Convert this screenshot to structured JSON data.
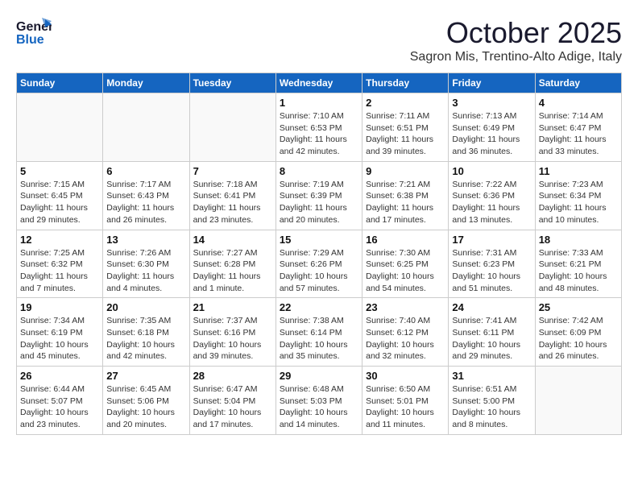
{
  "header": {
    "logo_general": "General",
    "logo_blue": "Blue",
    "month_year": "October 2025",
    "location": "Sagron Mis, Trentino-Alto Adige, Italy"
  },
  "weekdays": [
    "Sunday",
    "Monday",
    "Tuesday",
    "Wednesday",
    "Thursday",
    "Friday",
    "Saturday"
  ],
  "weeks": [
    [
      {
        "day": "",
        "info": ""
      },
      {
        "day": "",
        "info": ""
      },
      {
        "day": "",
        "info": ""
      },
      {
        "day": "1",
        "info": "Sunrise: 7:10 AM\nSunset: 6:53 PM\nDaylight: 11 hours and 42 minutes."
      },
      {
        "day": "2",
        "info": "Sunrise: 7:11 AM\nSunset: 6:51 PM\nDaylight: 11 hours and 39 minutes."
      },
      {
        "day": "3",
        "info": "Sunrise: 7:13 AM\nSunset: 6:49 PM\nDaylight: 11 hours and 36 minutes."
      },
      {
        "day": "4",
        "info": "Sunrise: 7:14 AM\nSunset: 6:47 PM\nDaylight: 11 hours and 33 minutes."
      }
    ],
    [
      {
        "day": "5",
        "info": "Sunrise: 7:15 AM\nSunset: 6:45 PM\nDaylight: 11 hours and 29 minutes."
      },
      {
        "day": "6",
        "info": "Sunrise: 7:17 AM\nSunset: 6:43 PM\nDaylight: 11 hours and 26 minutes."
      },
      {
        "day": "7",
        "info": "Sunrise: 7:18 AM\nSunset: 6:41 PM\nDaylight: 11 hours and 23 minutes."
      },
      {
        "day": "8",
        "info": "Sunrise: 7:19 AM\nSunset: 6:39 PM\nDaylight: 11 hours and 20 minutes."
      },
      {
        "day": "9",
        "info": "Sunrise: 7:21 AM\nSunset: 6:38 PM\nDaylight: 11 hours and 17 minutes."
      },
      {
        "day": "10",
        "info": "Sunrise: 7:22 AM\nSunset: 6:36 PM\nDaylight: 11 hours and 13 minutes."
      },
      {
        "day": "11",
        "info": "Sunrise: 7:23 AM\nSunset: 6:34 PM\nDaylight: 11 hours and 10 minutes."
      }
    ],
    [
      {
        "day": "12",
        "info": "Sunrise: 7:25 AM\nSunset: 6:32 PM\nDaylight: 11 hours and 7 minutes."
      },
      {
        "day": "13",
        "info": "Sunrise: 7:26 AM\nSunset: 6:30 PM\nDaylight: 11 hours and 4 minutes."
      },
      {
        "day": "14",
        "info": "Sunrise: 7:27 AM\nSunset: 6:28 PM\nDaylight: 11 hours and 1 minute."
      },
      {
        "day": "15",
        "info": "Sunrise: 7:29 AM\nSunset: 6:26 PM\nDaylight: 10 hours and 57 minutes."
      },
      {
        "day": "16",
        "info": "Sunrise: 7:30 AM\nSunset: 6:25 PM\nDaylight: 10 hours and 54 minutes."
      },
      {
        "day": "17",
        "info": "Sunrise: 7:31 AM\nSunset: 6:23 PM\nDaylight: 10 hours and 51 minutes."
      },
      {
        "day": "18",
        "info": "Sunrise: 7:33 AM\nSunset: 6:21 PM\nDaylight: 10 hours and 48 minutes."
      }
    ],
    [
      {
        "day": "19",
        "info": "Sunrise: 7:34 AM\nSunset: 6:19 PM\nDaylight: 10 hours and 45 minutes."
      },
      {
        "day": "20",
        "info": "Sunrise: 7:35 AM\nSunset: 6:18 PM\nDaylight: 10 hours and 42 minutes."
      },
      {
        "day": "21",
        "info": "Sunrise: 7:37 AM\nSunset: 6:16 PM\nDaylight: 10 hours and 39 minutes."
      },
      {
        "day": "22",
        "info": "Sunrise: 7:38 AM\nSunset: 6:14 PM\nDaylight: 10 hours and 35 minutes."
      },
      {
        "day": "23",
        "info": "Sunrise: 7:40 AM\nSunset: 6:12 PM\nDaylight: 10 hours and 32 minutes."
      },
      {
        "day": "24",
        "info": "Sunrise: 7:41 AM\nSunset: 6:11 PM\nDaylight: 10 hours and 29 minutes."
      },
      {
        "day": "25",
        "info": "Sunrise: 7:42 AM\nSunset: 6:09 PM\nDaylight: 10 hours and 26 minutes."
      }
    ],
    [
      {
        "day": "26",
        "info": "Sunrise: 6:44 AM\nSunset: 5:07 PM\nDaylight: 10 hours and 23 minutes."
      },
      {
        "day": "27",
        "info": "Sunrise: 6:45 AM\nSunset: 5:06 PM\nDaylight: 10 hours and 20 minutes."
      },
      {
        "day": "28",
        "info": "Sunrise: 6:47 AM\nSunset: 5:04 PM\nDaylight: 10 hours and 17 minutes."
      },
      {
        "day": "29",
        "info": "Sunrise: 6:48 AM\nSunset: 5:03 PM\nDaylight: 10 hours and 14 minutes."
      },
      {
        "day": "30",
        "info": "Sunrise: 6:50 AM\nSunset: 5:01 PM\nDaylight: 10 hours and 11 minutes."
      },
      {
        "day": "31",
        "info": "Sunrise: 6:51 AM\nSunset: 5:00 PM\nDaylight: 10 hours and 8 minutes."
      },
      {
        "day": "",
        "info": ""
      }
    ]
  ]
}
